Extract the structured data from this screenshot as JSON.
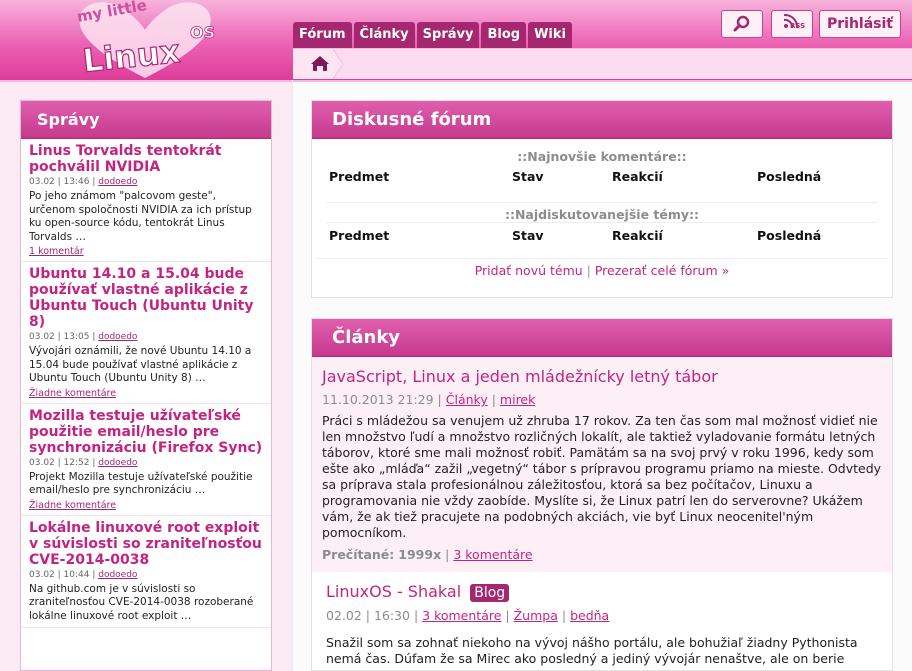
{
  "brand": {
    "logo_small": "my little",
    "logo_main": "Linux",
    "logo_suffix": "OS"
  },
  "nav": {
    "tabs": [
      "Fórum",
      "Články",
      "Správy",
      "Blog",
      "Wiki"
    ]
  },
  "header_actions": {
    "search_icon": "magnifier-icon",
    "rss_label": "RSS",
    "login_label": "Prihlásiť"
  },
  "breadcrumb": {
    "home_icon": "home-icon"
  },
  "sidebar": {
    "title": "Správy",
    "items": [
      {
        "title": "Linus Torvalds tentokrát pochválil NVIDIA",
        "date": "03.02 | 13:46 |",
        "author": "dodoedo",
        "text": "Po jeho známom \"palcovom geste\", určenom spoločnosti NVIDIA za ich prístup ku open-source kódu, tentokrát Linus Torvalds …",
        "comments": "1 komentár"
      },
      {
        "title": "Ubuntu 14.10 a 15.04 bude používať vlastné aplikácie z Ubuntu Touch (Ubuntu Unity 8)",
        "date": "03.02 | 13:05 |",
        "author": "dodoedo",
        "text": "Vývojári oznámili, že nové Ubuntu 14.10 a 15.04 bude používať vlastné aplikácie z Ubuntu Touch (Ubuntu Unity 8) …",
        "comments": "Žiadne komentáre"
      },
      {
        "title": "Mozilla testuje užívateľské použitie email/heslo pre synchronizáciu (Firefox Sync)",
        "date": "03.02 | 12:52 |",
        "author": "dodoedo",
        "text": "Projekt Mozilla testuje užívateľské použitie email/heslo pre synchronizáciu …",
        "comments": "Žiadne komentáre"
      },
      {
        "title": "Lokálne linuxové root exploit v súvislosti so zraniteľnosťou CVE-2014-0038",
        "date": "03.02 | 10:44 |",
        "author": "dodoedo",
        "text": "Na github.com je v súvislosti so zraniteľnosťou CVE-2014-0038 rozoberané lokálne linuxové root exploit …",
        "comments": ""
      }
    ]
  },
  "forum": {
    "title": "Diskusné fórum",
    "latest_heading": "::Najnovšie komentáre::",
    "hot_heading": "::Najdiskutovanejšie témy::",
    "columns": [
      "Predmet",
      "Stav",
      "Reakcií",
      "Posledná"
    ],
    "add_topic": "Pridať novú tému",
    "separator": "|",
    "browse_all": "Prezerať celé fórum »"
  },
  "articles": {
    "title": "Články",
    "items": [
      {
        "title": "JavaScript, Linux a jeden mládežnícky letný tábor",
        "date": "11.10.2013 21:29 |",
        "category": "Články",
        "sep": "|",
        "author": "mirek",
        "body": "Práci s mládežou sa venujem už zhruba 17 rokov. Za ten čas som mal možnosť vidieť nie len množstvo ľudí a množstvo rozličných lokalít, ale taktiež vyladovanie formátu letných táborov, ktoré sme mali možnosť robiť. Pamätám sa na svoj prvý v roku 1996, kedy som ešte ako „mláďa“ zažil „vegetný“ tábor s prípravou programu priamo na mieste. Odvtedy sa príprava stala profesionálnou záležitosťou, ktorá sa bez počítačov, Linuxu a programovania nie vždy zaobíde. Myslíte si, že Linux patrí len do serverovne? Ukážem vám, že ak tiež pracujete na podobných akciách, vie byť Linux neocenitel'ným pomocníkom.",
        "read_label": "Prečítané:",
        "read_count": "1999x",
        "comments": "3 komentáre"
      },
      {
        "title": "LinuxOS - Shakal",
        "badge": "Blog",
        "date": "02.02 | 16:30 |",
        "comments": "3 komentáre",
        "sep": "|",
        "tag": "Žumpa",
        "author": "bedňa",
        "body": "Snažil som sa zohnať niekoho na vývoj nášho portálu, ale bohužiaľ žiadny Pythonista nemá čas. Dúfam že sa Mirec ako posledný a jediný vývojár nenaštve, ale on berie"
      }
    ]
  },
  "colors": {
    "accent": "#c32482",
    "tab_bg": "#a4276f",
    "header_top": "#f7b3dc",
    "header_bottom": "#dd3d99"
  }
}
